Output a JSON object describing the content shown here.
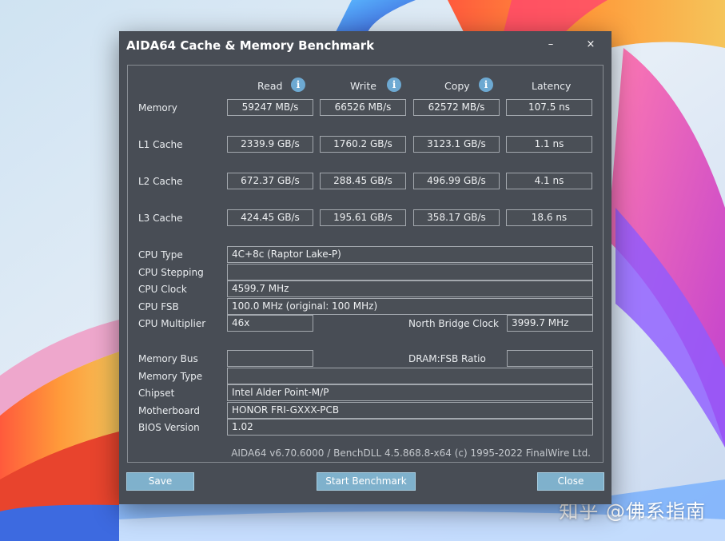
{
  "window": {
    "title": "AIDA64 Cache & Memory Benchmark",
    "minimize": "–",
    "close": "×"
  },
  "columns": [
    "Read",
    "Write",
    "Copy",
    "Latency"
  ],
  "rows": [
    {
      "label": "Memory",
      "read": "59247 MB/s",
      "write": "66526 MB/s",
      "copy": "62572 MB/s",
      "latency": "107.5 ns"
    },
    {
      "label": "L1 Cache",
      "read": "2339.9 GB/s",
      "write": "1760.2 GB/s",
      "copy": "3123.1 GB/s",
      "latency": "1.1 ns"
    },
    {
      "label": "L2 Cache",
      "read": "672.37 GB/s",
      "write": "288.45 GB/s",
      "copy": "496.99 GB/s",
      "latency": "4.1 ns"
    },
    {
      "label": "L3 Cache",
      "read": "424.45 GB/s",
      "write": "195.61 GB/s",
      "copy": "358.17 GB/s",
      "latency": "18.6 ns"
    }
  ],
  "cpu": {
    "type_label": "CPU Type",
    "type": "4C+8c   (Raptor Lake-P)",
    "stepping_label": "CPU Stepping",
    "stepping": "",
    "clock_label": "CPU Clock",
    "clock": "4599.7 MHz",
    "fsb_label": "CPU FSB",
    "fsb": "100.0 MHz  (original: 100 MHz)",
    "multiplier_label": "CPU Multiplier",
    "multiplier": "46x",
    "nb_clock_label": "North Bridge Clock",
    "nb_clock": "3999.7 MHz"
  },
  "system": {
    "membus_label": "Memory Bus",
    "membus": "",
    "dram_ratio_label": "DRAM:FSB Ratio",
    "dram_ratio": "",
    "memtype_label": "Memory Type",
    "memtype": "",
    "chipset_label": "Chipset",
    "chipset": "Intel Alder Point-M/P",
    "motherboard_label": "Motherboard",
    "motherboard": "HONOR FRI-GXXX-PCB",
    "bios_label": "BIOS Version",
    "bios": "1.02"
  },
  "footer": "AIDA64 v6.70.6000 / BenchDLL 4.5.868.8-x64  (c) 1995-2022 FinalWire Ltd.",
  "buttons": {
    "save": "Save",
    "start": "Start Benchmark",
    "close": "Close"
  },
  "watermark": "知乎 @佛系指南",
  "icons": {
    "info": "info-icon"
  },
  "colors": {
    "window_bg": "#484d55",
    "button_bg": "#7fb1cc",
    "info_icon": "#6da9d2"
  }
}
